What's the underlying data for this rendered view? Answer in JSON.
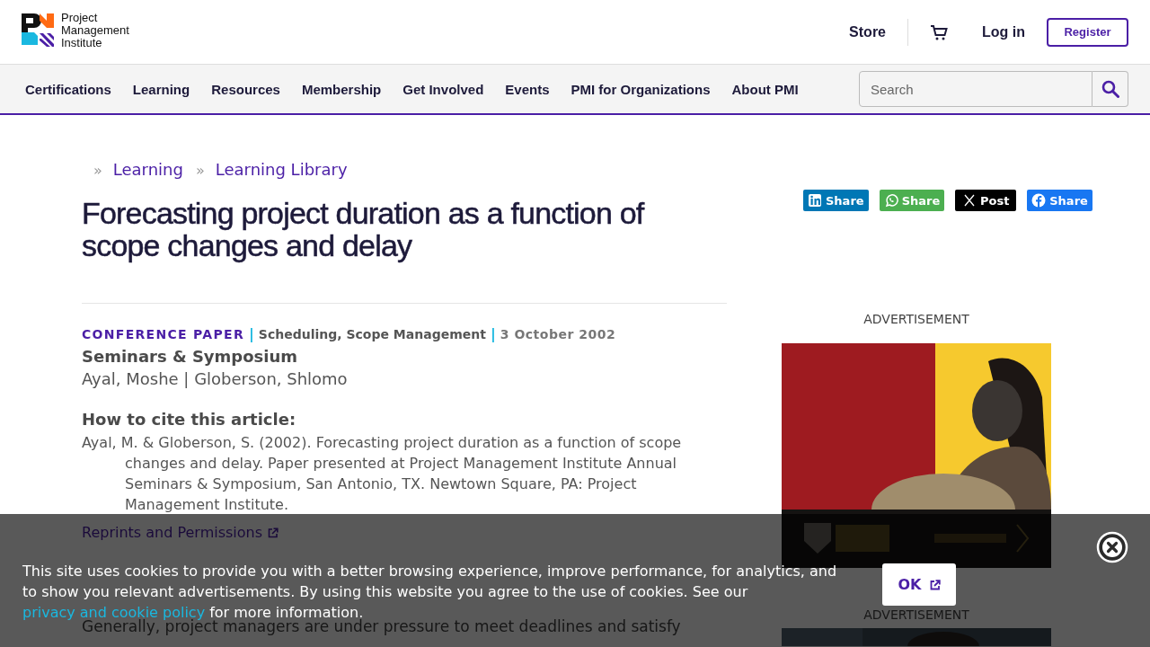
{
  "header": {
    "logo_text": "Project Management Institute",
    "links": [
      {
        "kind": "link",
        "label": "Store"
      },
      {
        "kind": "cart"
      },
      {
        "kind": "link",
        "label": "Log in"
      },
      {
        "kind": "button",
        "label": "Register"
      }
    ]
  },
  "nav": {
    "items": [
      "Certifications",
      "Learning",
      "Resources",
      "Membership",
      "Get Involved",
      "Events",
      "PMI for Organizations",
      "About PMI"
    ],
    "search": {
      "placeholder": "Search"
    }
  },
  "breadcrumb": [
    {
      "separator": "»",
      "label": "Learning"
    },
    {
      "separator": "»",
      "label": "Learning Library"
    }
  ],
  "share_buttons": [
    {
      "kind": "linkedin",
      "label": "Share"
    },
    {
      "kind": "whatsapp",
      "label": "Share"
    },
    {
      "kind": "x",
      "label": "Post"
    },
    {
      "kind": "facebook",
      "label": "Share"
    }
  ],
  "article": {
    "title": "Forecasting project duration as a function of scope changes and delay",
    "meta": [
      {
        "kind": "type",
        "text": "CONFERENCE PAPER"
      },
      {
        "kind": "separator",
        "text": "|"
      },
      {
        "kind": "topics",
        "text": "Scheduling, Scope Management"
      },
      {
        "kind": "separator",
        "text": "|"
      },
      {
        "kind": "date",
        "text": "3 October 2002"
      }
    ],
    "event": "Seminars & Symposium",
    "authors": "Ayal, Moshe | Globerson, Shlomo",
    "cite_heading": "How to cite this article:",
    "citation": "Ayal, M. & Globerson, S. (2002). Forecasting project duration as a function of scope changes and delay. Paper presented at Project Management Institute Annual Seminars & Symposium, San Antonio, TX. Newtown Square, PA: Project Management Institute.",
    "reprints_link": "Reprints and Permissions",
    "paragraph": "Generally, project managers are under pressure to meet deadlines and satisfy"
  },
  "ads": [
    {
      "label": "ADVERTISEMENT",
      "kind": "picture"
    },
    {
      "label": "ADVERTISEMENT",
      "kind": "picture"
    }
  ],
  "cookie_banner": {
    "text_before": "This site uses cookies to provide you with a better browsing experience, improve performance, for analytics, and to show you relevant advertisements. By using this website you agree to the use of cookies. See our ",
    "link": "privacy and cookie policy",
    "text_after": " for more information.",
    "button": "OK"
  }
}
